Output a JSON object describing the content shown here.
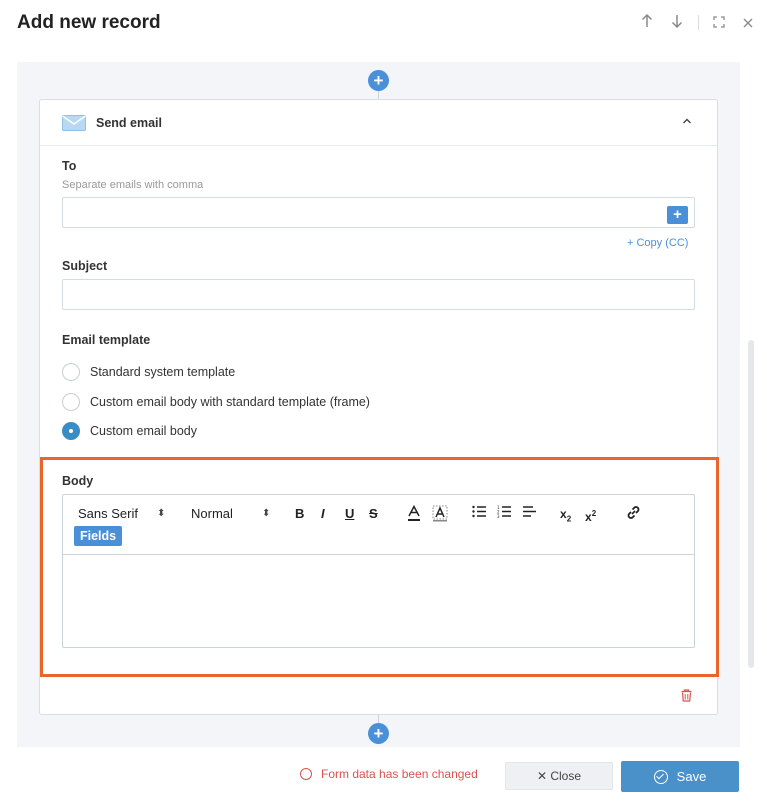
{
  "header": {
    "title": "Add new record",
    "controls": {
      "up_icon": "arrow-up",
      "down_icon": "arrow-down",
      "expand_icon": "expand",
      "close_icon": "close"
    }
  },
  "card": {
    "icon": "envelope",
    "title": "Send email",
    "to": {
      "label": "To",
      "hint": "Separate emails with comma",
      "value": "",
      "add_label": "+",
      "copy_cc": "+ Copy (CC)"
    },
    "subject": {
      "label": "Subject",
      "value": ""
    },
    "template": {
      "label": "Email template",
      "options": [
        {
          "label": "Standard system template",
          "checked": false
        },
        {
          "label": "Custom email body with standard template (frame)",
          "checked": false
        },
        {
          "label": "Custom email body",
          "checked": true
        }
      ]
    },
    "body": {
      "label": "Body",
      "toolbar": {
        "font": "Sans Serif",
        "size": "Normal",
        "bold": "B",
        "italic": "I",
        "underline": "U",
        "strike": "S",
        "fields": "Fields"
      },
      "content": ""
    }
  },
  "footer": {
    "status": "Form data has been changed",
    "close": "✕ Close",
    "save": "Save"
  },
  "colors": {
    "accent": "#4a90d9",
    "highlight": "#e8662a",
    "warning": "#d9534f"
  }
}
